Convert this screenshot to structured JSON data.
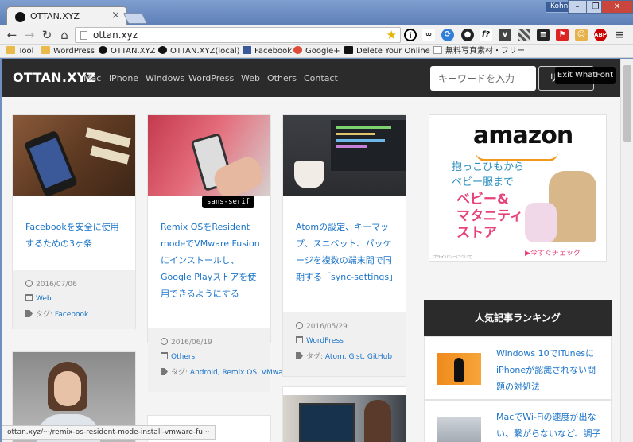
{
  "browser": {
    "tab_title": "OTTAN.XYZ",
    "tab_close": "×",
    "user": "Kohno",
    "window_controls": [
      "–",
      "❐",
      "✕"
    ],
    "url": "ottan.xyz",
    "nav": {
      "back": "←",
      "forward": "→",
      "reload": "↻",
      "home": "⌂"
    },
    "extensions": [
      "info-icon",
      "glasses-icon",
      "sync-icon",
      "record-icon",
      "font-icon",
      "pocket-icon",
      "grid-icon",
      "layers-icon",
      "flag-icon",
      "monkey-icon",
      "adblock-icon",
      "menu-icon"
    ],
    "ext_labels": {
      "font": "f?",
      "abp": "ABP"
    },
    "bookmarks": [
      "Tool",
      "WordPress",
      "OTTAN.XYZ",
      "OTTAN.XYZ(local)",
      "Facebook",
      "Google+",
      "Delete Your Online",
      "無料写真素材・フリー"
    ],
    "status_url": "ottan.xyz/···/remix-os-resident-mode-install-vmware-fu···"
  },
  "site": {
    "logo": "OTTAN.XYZ",
    "nav": [
      "Mac",
      "iPhone",
      "Windows",
      "WordPress",
      "Web",
      "Others",
      "Contact"
    ],
    "search_placeholder": "キーワードを入力",
    "search_button": "サ",
    "whatfont_button": "Exit WhatFont",
    "font_badge": "sans-serif"
  },
  "posts": [
    {
      "title": "Facebookを安全に使用するための3ヶ条",
      "date": "2016/07/06",
      "category": "Web",
      "tags_label": "タグ:",
      "tags": "Facebook"
    },
    {
      "title": "Remix OSをResident modeでVMware Fusionにインストールし、Google Playストアを使用できるようにする",
      "date": "2016/06/19",
      "category": "Others",
      "tags_label": "タグ:",
      "tags": "Android, Remix OS, VMware Fusion"
    },
    {
      "title": "Atomの設定、キーマップ、スニペット、パッケージを複数の端末間で同期する「sync-settings」",
      "date": "2016/05/29",
      "category": "WordPress",
      "tags_label": "タグ:",
      "tags": "Atom, Gist, GitHub"
    }
  ],
  "ad": {
    "brand": "amazon",
    "line1": "抱っこひもから",
    "line1b": "ベビー服まで",
    "line2": "ベビー&",
    "line2b": "マタニティ",
    "line2c": "ストア",
    "cta": "▶今すぐチェック",
    "privacy": "プライバシーについて"
  },
  "ranking": {
    "heading": "人気記事ランキング",
    "items": [
      {
        "title": "Windows 10でiTunesにiPhoneが認識されない問題の対処法"
      },
      {
        "title": "MacでWi-Fiの速度が出ない、繋がらないなど、調子"
      }
    ]
  },
  "colors": {
    "link": "#1a73c8",
    "nav_bg": "#2b2b2b",
    "ad_pink": "#e7437a",
    "ad_blue": "#2b8fc0",
    "amazon_orange": "#f29a1f"
  }
}
